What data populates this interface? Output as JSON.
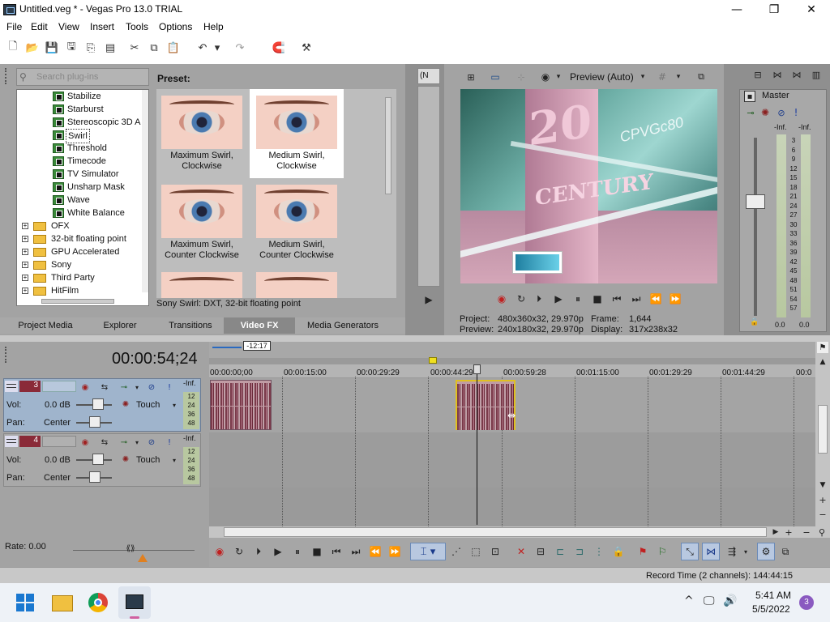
{
  "window": {
    "title": "Untitled.veg * - Vegas Pro 13.0 TRIAL",
    "minimize": "—",
    "maximize": "❐",
    "close": "✕"
  },
  "menu": [
    "File",
    "Edit",
    "View",
    "Insert",
    "Tools",
    "Options",
    "Help"
  ],
  "plugins": {
    "search_placeholder": "Search plug-ins",
    "tree": [
      "Stabilize",
      "Starburst",
      "Stereoscopic 3D A",
      "Swirl",
      "Threshold",
      "Timecode",
      "TV Simulator",
      "Unsharp Mask",
      "Wave",
      "White Balance"
    ],
    "folders": [
      "OFX",
      "32-bit floating point",
      "GPU Accelerated",
      "Sony",
      "Third Party",
      "HitFilm"
    ],
    "selected": "Swirl"
  },
  "presets": {
    "header": "Preset:",
    "items": [
      "Maximum Swirl, Clockwise",
      "Medium Swirl, Clockwise",
      "Maximum Swirl, Counter Clockwise",
      "Medium Swirl, Counter Clockwise"
    ],
    "selected": "Medium Swirl, Clockwise",
    "status": "Sony Swirl: DXT, 32-bit floating point"
  },
  "tabs": [
    "Project Media",
    "Explorer",
    "Transitions",
    "Video FX",
    "Media Generators"
  ],
  "active_tab": "Video FX",
  "preview": {
    "mode": "Preview (Auto)",
    "dropdown_short": "(N",
    "project_label": "Project:",
    "project_value": "480x360x32, 29.970p",
    "preview_label": "Preview:",
    "preview_value": "240x180x32, 29.970p",
    "frame_label": "Frame:",
    "frame_value": "1,644",
    "display_label": "Display:",
    "display_value": "317x238x32",
    "logo_text_1": "20",
    "logo_text_2": "CENTURY",
    "logo_text_3": "CPVGc80"
  },
  "master": {
    "title": "Master",
    "left_inf": "-Inf.",
    "right_inf": "-Inf.",
    "scale": [
      "3",
      "6",
      "9",
      "12",
      "15",
      "18",
      "21",
      "24",
      "27",
      "30",
      "33",
      "36",
      "39",
      "42",
      "45",
      "48",
      "51",
      "54",
      "57"
    ],
    "left_val": "0.0",
    "right_val": "0.0"
  },
  "timeline": {
    "timecode": "00:00:54;24",
    "region_label": "-12:17",
    "ruler": [
      "00:00:00;00",
      "00:00:15:00",
      "00:00:29:29",
      "00:00:44:29",
      "00:00:59:28",
      "00:01:15:00",
      "00:01:29:29",
      "00:01:44:29",
      "00:0"
    ],
    "tracks": [
      {
        "number": "3",
        "vol_label": "Vol:",
        "vol_value": "0.0 dB",
        "pan_label": "Pan:",
        "pan_value": "Center",
        "mode": "Touch",
        "inf": "-Inf.",
        "meter": [
          "12",
          "24",
          "36",
          "48"
        ]
      },
      {
        "number": "4",
        "vol_label": "Vol:",
        "vol_value": "0.0 dB",
        "pan_label": "Pan:",
        "pan_value": "Center",
        "mode": "Touch",
        "inf": "-Inf.",
        "meter": [
          "12",
          "24",
          "36",
          "48"
        ]
      }
    ],
    "rate": "Rate: 0.00",
    "record_time": "Record Time (2 channels): 144:44:15"
  },
  "taskbar": {
    "time": "5:41 AM",
    "date": "5/5/2022",
    "badge": "3"
  },
  "colors": {
    "accent_track": "#9fb4cc",
    "clip": "#c09ca4",
    "selected_preset_bg": "#ffffff",
    "panel": "#a3a3a3"
  }
}
